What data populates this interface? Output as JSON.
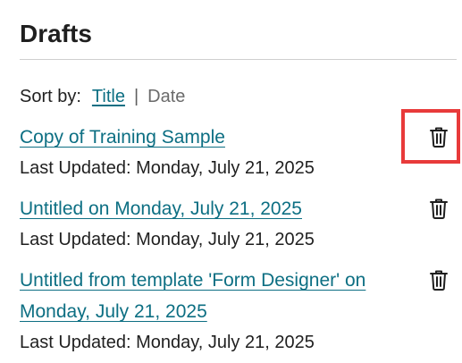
{
  "header": {
    "title": "Drafts"
  },
  "sort": {
    "label": "Sort by:",
    "title_option": "Title",
    "separator": "|",
    "date_option": "Date",
    "active": "Title"
  },
  "drafts": [
    {
      "title": "Copy of Training Sample",
      "meta": "Last Updated: Monday, July 21, 2025",
      "delete_icon": "trash-icon",
      "highlighted": true
    },
    {
      "title": "Untitled on Monday, July 21, 2025",
      "meta": "Last Updated: Monday, July 21, 2025",
      "delete_icon": "trash-icon",
      "highlighted": false
    },
    {
      "title": "Untitled from template 'Form Designer' on Monday, July 21, 2025",
      "meta": "Last Updated: Monday, July 21, 2025",
      "delete_icon": "trash-icon",
      "highlighted": false
    }
  ],
  "colors": {
    "link": "#0d6f83",
    "text": "#1f1f1f",
    "muted": "#6b6b6b",
    "highlight": "#e83a3a",
    "divider": "#cfcfcf"
  }
}
